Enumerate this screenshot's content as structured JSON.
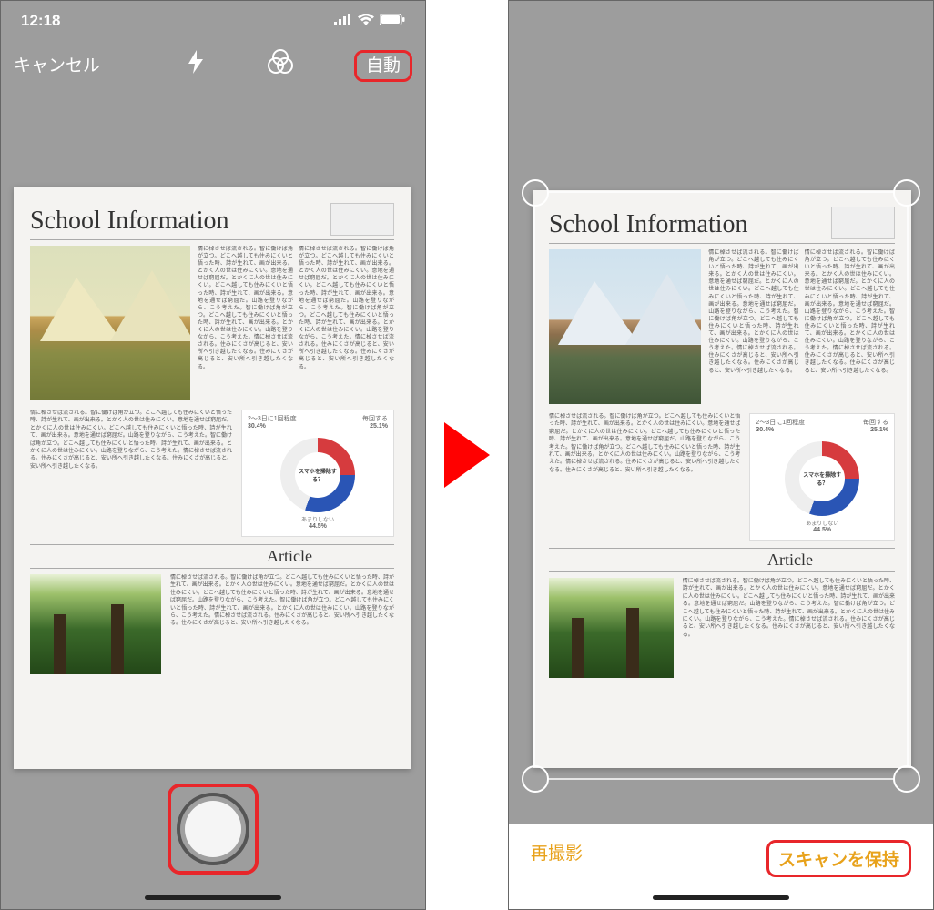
{
  "status_bar": {
    "time": "12:18",
    "signal_icon": "signal-icon",
    "wifi_icon": "wifi-icon",
    "battery_icon": "battery-icon"
  },
  "left": {
    "cancel": "キャンセル",
    "flash_icon": "flash-icon",
    "filter_icon": "filter-rings-icon",
    "auto_label": "自動",
    "shutter": "shutter-button"
  },
  "right": {
    "retake": "再撮影",
    "keep_scan": "スキャンを保持"
  },
  "document": {
    "title": "School Information",
    "article_heading": "Article",
    "body_filler": "情に棹させば流される。智に働けば角が立つ。どこへ越しても住みにくいと悟った時、詩が生れて、画が出来る。とかく人の世は住みにくい。意地を通せば窮屈だ。とかくに人の世は住みにくい。どこへ越しても住みにくいと悟った時、詩が生れて、画が出来る。意地を通せば窮屈だ。山路を登りながら、こう考えた。智に働けば角が立つ。どこへ越しても住みにくいと悟った時、詩が生れて、画が出来る。とかくに人の世は住みにくい。山路を登りながら、こう考えた。情に棹させば流される。住みにくさが高じると、安い所へ引き越したくなる。住みにくさが高じると、安い所へ引き越したくなる。"
  },
  "chart_data": {
    "type": "pie",
    "title": "スマホを掃除する？",
    "top_left_label": "2〜3日に1回程度",
    "top_right_label": "毎回する",
    "bottom_label": "あまりしない",
    "series": [
      {
        "name": "2〜3日に1回程度",
        "value": 30.4,
        "color": "#d63b3e"
      },
      {
        "name": "毎回する",
        "value": 25.1,
        "color": "#2a55b5"
      },
      {
        "name": "あまりしない",
        "value": 44.5,
        "color": "#eeeeee"
      }
    ],
    "labels": {
      "tl_value": "30.4%",
      "tr_value": "25.1%",
      "bottom_value": "44.5%"
    }
  },
  "colors": {
    "highlight_red": "#e8262a",
    "accent_orange": "#e8a21c"
  }
}
